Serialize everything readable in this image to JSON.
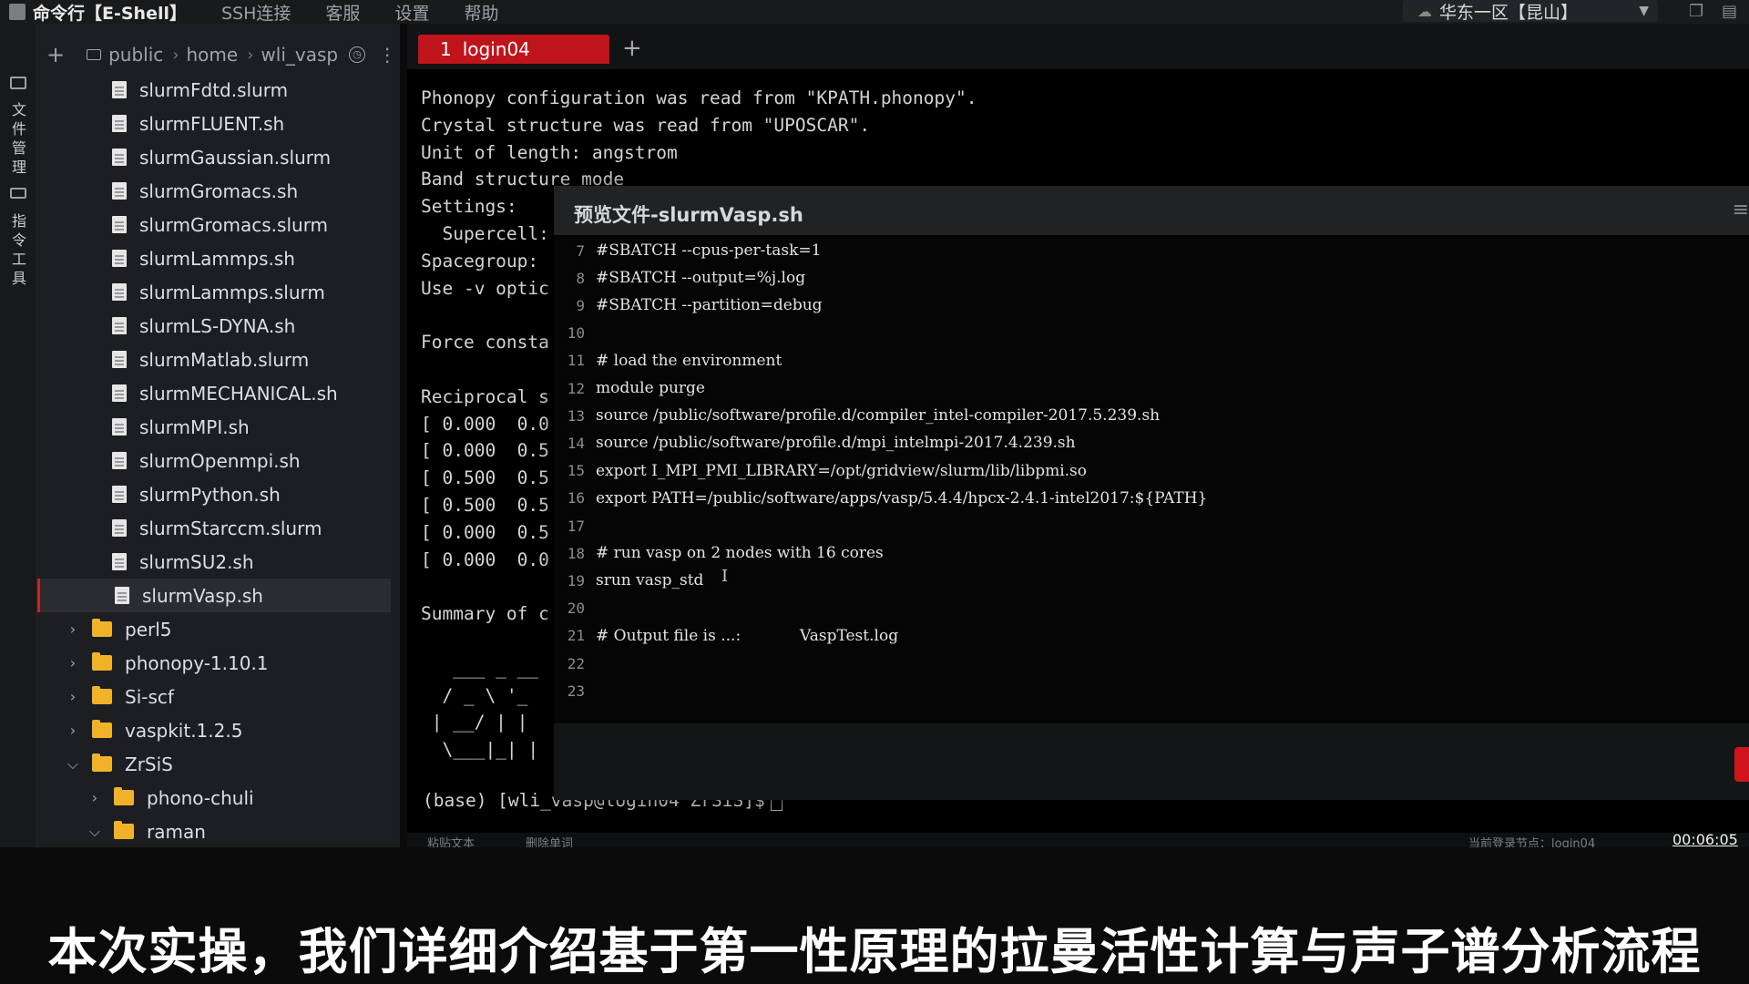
{
  "menubar": {
    "app_title": "命令行【E-Shell】",
    "items": [
      "SSH连接",
      "客服",
      "设置",
      "帮助"
    ],
    "region": "华东一区【昆山】"
  },
  "activity": {
    "file_manager_label": "文件管理",
    "command_tools_label": "指令工具"
  },
  "breadcrumb": [
    "public",
    "home",
    "wli_vasp"
  ],
  "file_tree": [
    {
      "type": "file",
      "name": "slurmFdtd.slurm"
    },
    {
      "type": "file",
      "name": "slurmFLUENT.sh"
    },
    {
      "type": "file",
      "name": "slurmGaussian.slurm"
    },
    {
      "type": "file",
      "name": "slurmGromacs.sh"
    },
    {
      "type": "file",
      "name": "slurmGromacs.slurm"
    },
    {
      "type": "file",
      "name": "slurmLammps.sh"
    },
    {
      "type": "file",
      "name": "slurmLammps.slurm"
    },
    {
      "type": "file",
      "name": "slurmLS-DYNA.sh"
    },
    {
      "type": "file",
      "name": "slurmMatlab.slurm"
    },
    {
      "type": "file",
      "name": "slurmMECHANICAL.sh"
    },
    {
      "type": "file",
      "name": "slurmMPI.sh"
    },
    {
      "type": "file",
      "name": "slurmOpenmpi.sh"
    },
    {
      "type": "file",
      "name": "slurmPython.sh"
    },
    {
      "type": "file",
      "name": "slurmStarccm.slurm"
    },
    {
      "type": "file",
      "name": "slurmSU2.sh"
    },
    {
      "type": "file",
      "name": "slurmVasp.sh",
      "selected": true
    },
    {
      "type": "folder",
      "name": "perl5",
      "expanded": false
    },
    {
      "type": "folder",
      "name": "phonopy-1.10.1",
      "expanded": false
    },
    {
      "type": "folder",
      "name": "Si-scf",
      "expanded": false
    },
    {
      "type": "folder",
      "name": "vaspkit.1.2.5",
      "expanded": false
    },
    {
      "type": "folder",
      "name": "ZrSiS",
      "expanded": true
    },
    {
      "type": "folder",
      "name": "phono-chuli",
      "expanded": false,
      "child": true
    },
    {
      "type": "folder",
      "name": "raman",
      "expanded": true,
      "child": true
    }
  ],
  "tab": {
    "number": "1",
    "name": "login04"
  },
  "terminal_lines": [
    {
      "row": 0,
      "text": "Phonopy configuration was read from \"KPATH.phonopy\"."
    },
    {
      "row": 1,
      "text": "Crystal structure was read from \"UPOSCAR\"."
    },
    {
      "row": 2,
      "text": "Unit of length: angstrom"
    },
    {
      "row": 3,
      "text": "Band structure mode"
    },
    {
      "row": 4,
      "text": "Settings:"
    },
    {
      "row": 5,
      "text": "  Supercell:"
    },
    {
      "row": 6,
      "text": "Spacegroup:"
    },
    {
      "row": 7,
      "text": "Use -v optic"
    },
    {
      "row": 9,
      "text": "Force consta"
    },
    {
      "row": 11,
      "text": "Reciprocal s"
    },
    {
      "row": 12,
      "text": "[ 0.000  0.0"
    },
    {
      "row": 13,
      "text": "[ 0.000  0.5"
    },
    {
      "row": 14,
      "text": "[ 0.500  0.5"
    },
    {
      "row": 15,
      "text": "[ 0.500  0.5"
    },
    {
      "row": 16,
      "text": "[ 0.000  0.5"
    },
    {
      "row": 17,
      "text": "[ 0.000  0.0"
    },
    {
      "row": 19,
      "text": "Summary of c"
    },
    {
      "row": 21,
      "text": "   ___ _ __"
    },
    {
      "row": 22,
      "text": "  / _ \\ '_"
    },
    {
      "row": 23,
      "text": " | __/ | |"
    },
    {
      "row": 24,
      "text": "  \\___|_| |"
    }
  ],
  "terminal_prompt": "(base) [wli_vasp@login04 ZrSiS]$",
  "preview": {
    "title": "预览文件-slurmVasp.sh",
    "lines": [
      {
        "n": "7",
        "text": "#SBATCH --cpus-per-task=1"
      },
      {
        "n": "8",
        "text": "#SBATCH --output=%j.log"
      },
      {
        "n": "9",
        "text": "#SBATCH --partition=debug"
      },
      {
        "n": "10",
        "text": ""
      },
      {
        "n": "11",
        "text": "# load the environment"
      },
      {
        "n": "12",
        "text": "module purge"
      },
      {
        "n": "13",
        "text": "source /public/software/profile.d/compiler_intel-compiler-2017.5.239.sh"
      },
      {
        "n": "14",
        "text": "source /public/software/profile.d/mpi_intelmpi-2017.4.239.sh"
      },
      {
        "n": "15",
        "text": "export I_MPI_PMI_LIBRARY=/opt/gridview/slurm/lib/libpmi.so"
      },
      {
        "n": "16",
        "text": "export PATH=/public/software/apps/vasp/5.4.4/hpcx-2.4.1-intel2017:${PATH}"
      },
      {
        "n": "17",
        "text": ""
      },
      {
        "n": "18",
        "text": "# run vasp on 2 nodes with 16 cores"
      },
      {
        "n": "19",
        "text": "srun vasp_std"
      },
      {
        "n": "20",
        "text": ""
      },
      {
        "n": "21",
        "text": "# Output file is ...:            VaspTest.log"
      },
      {
        "n": "22",
        "text": ""
      },
      {
        "n": "23",
        "text": ""
      }
    ]
  },
  "statusbar": {
    "paste_text": "粘贴文本",
    "delete_word": "删除单词",
    "node_info": "当前登录节点：login04"
  },
  "video_time": "00:06:05",
  "subtitle": "本次实操，我们详细介绍基于第一性原理的拉曼活性计算与声子谱分析流程"
}
